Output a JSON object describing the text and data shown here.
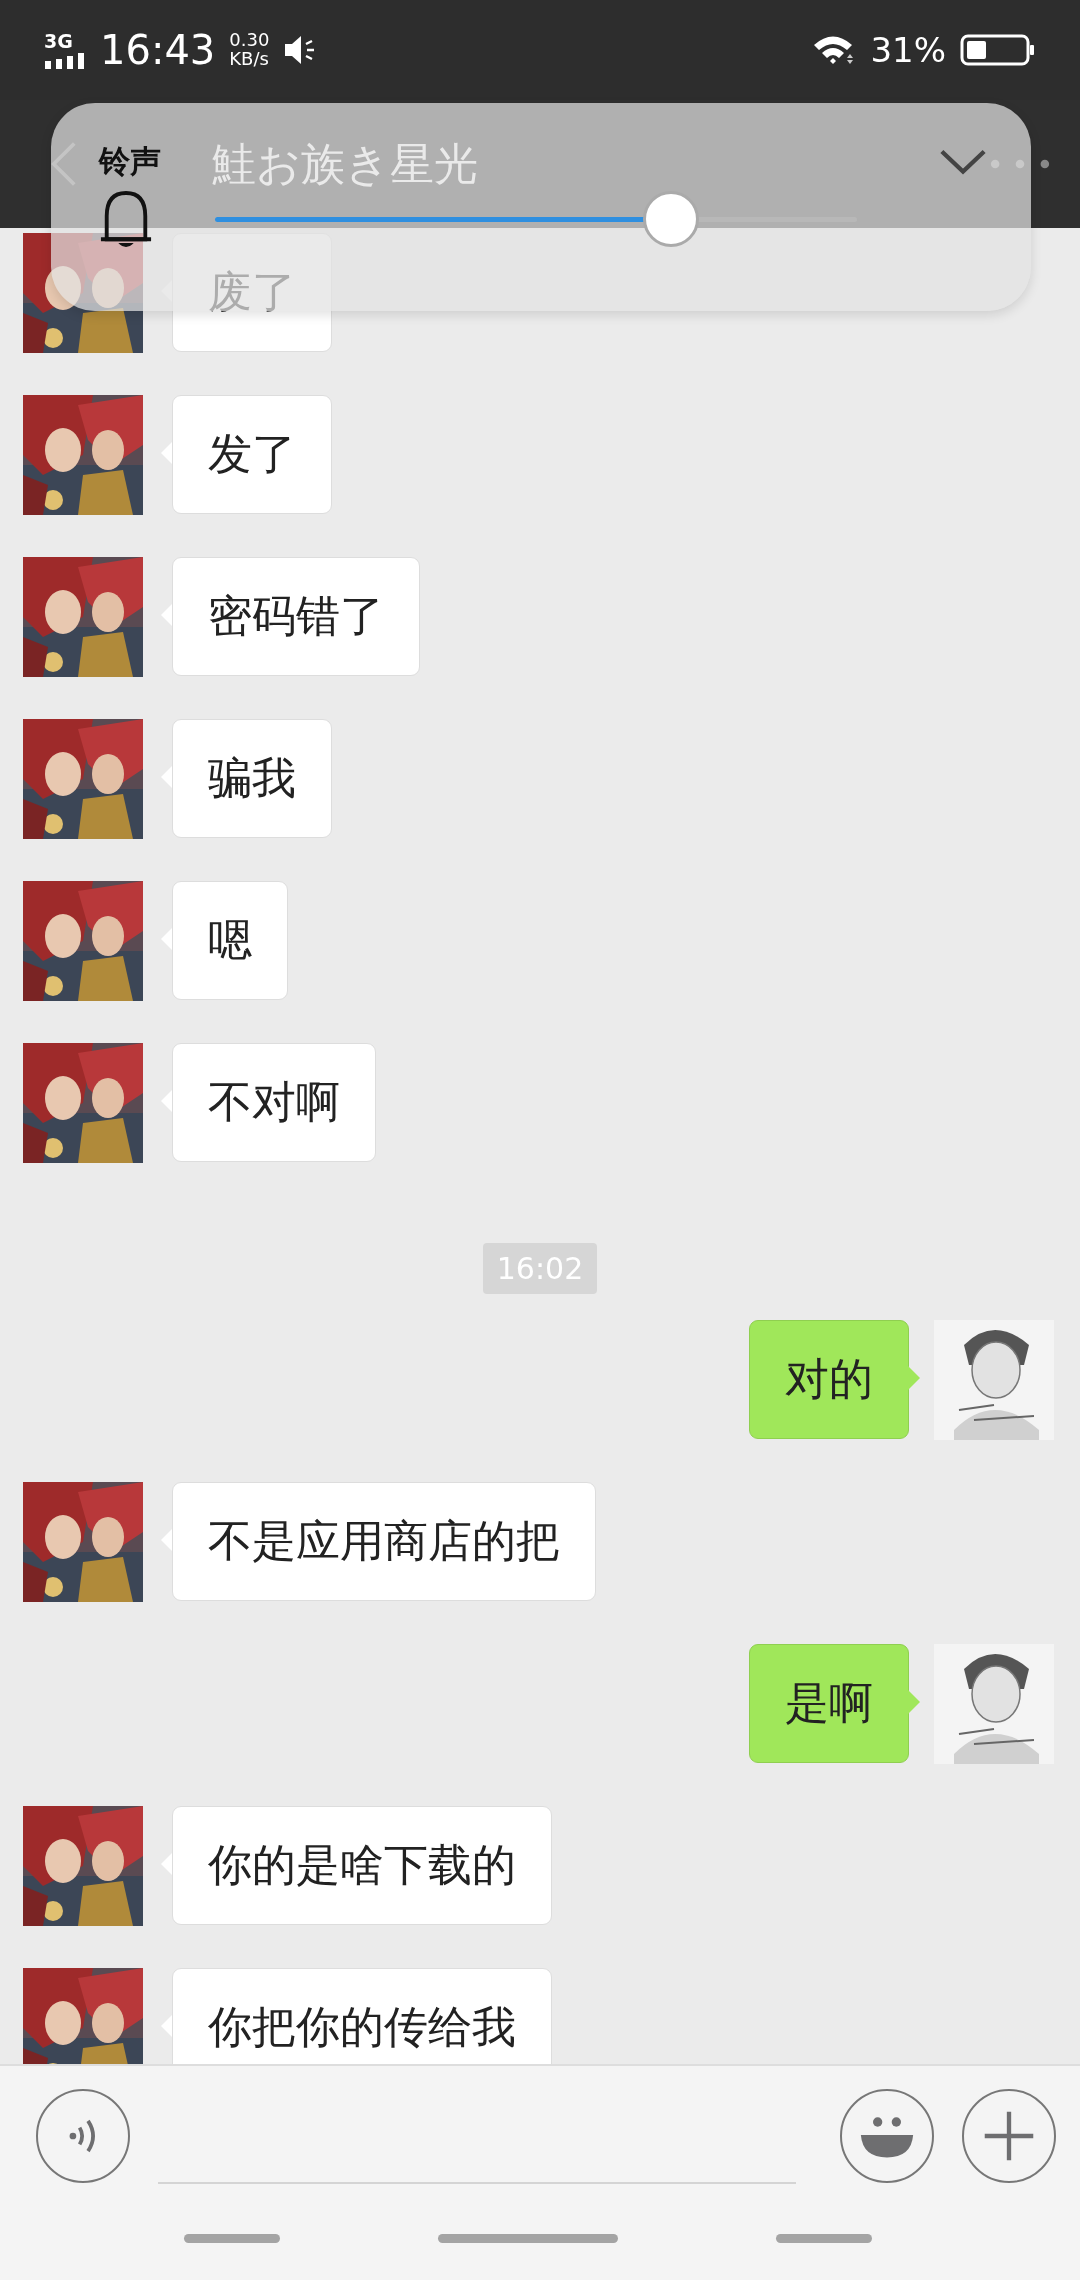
{
  "status_bar": {
    "network": "3G",
    "time": "16:43",
    "speed": "0.30",
    "speed_unit": "KB/s",
    "battery": "31%"
  },
  "header": {
    "title": "鮭お族き星光"
  },
  "volume_panel": {
    "label": "铃声",
    "level": 0.71
  },
  "messages": [
    {
      "kind": "in",
      "text": "废了"
    },
    {
      "kind": "in",
      "text": "发了"
    },
    {
      "kind": "in",
      "text": "密码错了"
    },
    {
      "kind": "in",
      "text": "骗我"
    },
    {
      "kind": "in",
      "text": "嗯"
    },
    {
      "kind": "in",
      "text": "不对啊"
    },
    {
      "kind": "time",
      "text": "16:02"
    },
    {
      "kind": "out",
      "text": "对的"
    },
    {
      "kind": "in",
      "text": "不是应用商店的把"
    },
    {
      "kind": "out",
      "text": "是啊"
    },
    {
      "kind": "in",
      "text": "你的是啥下载的"
    },
    {
      "kind": "in",
      "text": "你把你的传给我"
    }
  ]
}
